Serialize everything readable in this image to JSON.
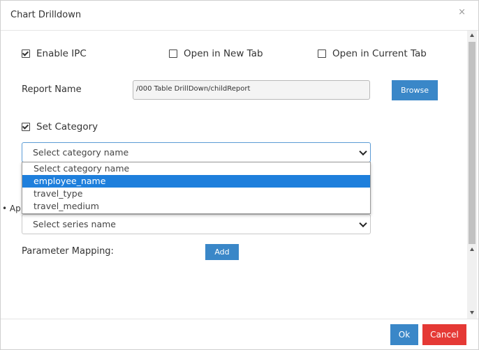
{
  "dialog": {
    "title": "Chart Drilldown",
    "close_glyph": "×"
  },
  "options": {
    "enable_ipc": {
      "label": "Enable IPC",
      "checked": true
    },
    "open_new_tab": {
      "label": "Open in New Tab",
      "checked": false
    },
    "open_current_tab": {
      "label": "Open in Current Tab",
      "checked": false
    }
  },
  "report": {
    "label": "Report Name",
    "value": "/000 Table DrillDown/childReport",
    "browse_label": "Browse"
  },
  "category": {
    "checkbox_label": "Set Category",
    "checked": true,
    "selected": "Select category name",
    "options": [
      "Select category name",
      "employee_name",
      "travel_type",
      "travel_medium"
    ],
    "highlighted": "employee_name"
  },
  "series": {
    "partial_label": "Ap",
    "selected": "Select series name"
  },
  "parameter_mapping": {
    "label": "Parameter Mapping:",
    "add_label": "Add"
  },
  "footer": {
    "ok_label": "Ok",
    "cancel_label": "Cancel"
  },
  "colors": {
    "primary": "#3a87c8",
    "danger": "#e53935",
    "highlight": "#1e7fdc"
  }
}
